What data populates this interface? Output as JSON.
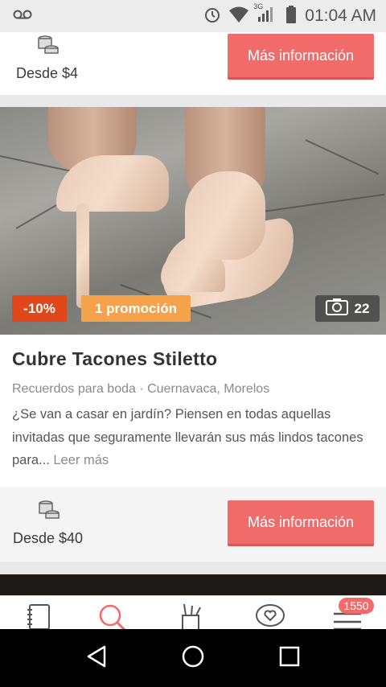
{
  "status_bar": {
    "time": "01:04 AM",
    "network_label": "3G",
    "icons": [
      "voicemail-icon",
      "alarm-icon",
      "wifi-icon",
      "signal-icon",
      "battery-icon"
    ]
  },
  "card1": {
    "price_label": "Desde $4",
    "cta_label": "Más información"
  },
  "card2": {
    "discount_badge": "-10%",
    "promo_badge": "1 promoción",
    "photo_count": "22",
    "title": "Cubre Tacones Stiletto",
    "meta": "Recuerdos para boda · Cuernavaca, Morelos",
    "description": "¿Se van a casar en jardín? Piensen en todas aquellas invitadas que seguramente llevarán sus más lindos tacones para...",
    "read_more": "Leer más",
    "price_label": "Desde $40",
    "cta_label": "Más información"
  },
  "bottom_nav": {
    "items": [
      "notebook-icon",
      "search-icon",
      "tools-icon",
      "chat-heart-icon",
      "menu-icon"
    ],
    "notification_count": "1550",
    "active_color": "#f26b6b"
  },
  "colors": {
    "accent": "#f26b6b",
    "discount": "#e0471b",
    "promo": "#f5a24a"
  }
}
